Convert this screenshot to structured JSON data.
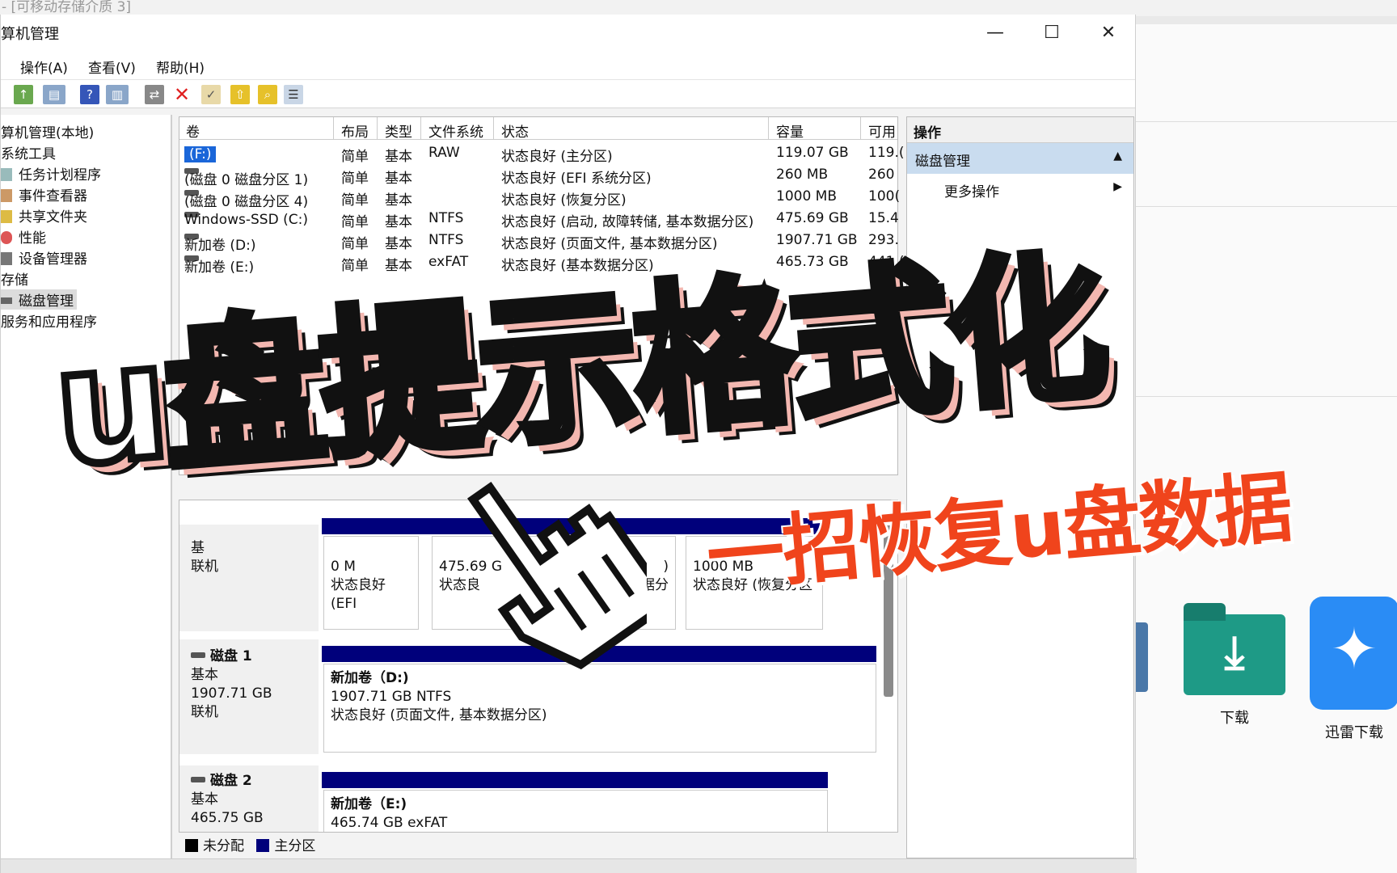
{
  "background": {
    "top_title": "- [可移动存储介质 3]",
    "desktop_icons": [
      {
        "label": "下载",
        "icon": "download-folder-icon"
      },
      {
        "label": "迅雷下载",
        "icon": "thunder-bird-icon"
      }
    ]
  },
  "window": {
    "title": "算机管理",
    "controls": {
      "minimize": "—",
      "maximize": "☐",
      "close": "✕"
    },
    "menu": [
      "操作(A)",
      "查看(V)",
      "帮助(H)"
    ]
  },
  "tree": {
    "items": [
      "算机管理(本地)",
      "系统工具",
      "任务计划程序",
      "事件查看器",
      "共享文件夹",
      "性能",
      "设备管理器",
      "存储",
      "磁盘管理",
      "服务和应用程序"
    ]
  },
  "volumes": {
    "columns": [
      "卷",
      "布局",
      "类型",
      "文件系统",
      "状态",
      "容量",
      "可用"
    ],
    "rows": [
      {
        "name": "(F:)",
        "layout": "简单",
        "type": "基本",
        "fs": "RAW",
        "status": "状态良好 (主分区)",
        "capacity": "119.07 GB",
        "free": "119.("
      },
      {
        "name": "(磁盘 0 磁盘分区 1)",
        "layout": "简单",
        "type": "基本",
        "fs": "",
        "status": "状态良好 (EFI 系统分区)",
        "capacity": "260 MB",
        "free": "260"
      },
      {
        "name": "(磁盘 0 磁盘分区 4)",
        "layout": "简单",
        "type": "基本",
        "fs": "",
        "status": "状态良好 (恢复分区)",
        "capacity": "1000 MB",
        "free": "100("
      },
      {
        "name": "Windows-SSD (C:)",
        "layout": "简单",
        "type": "基本",
        "fs": "NTFS",
        "status": "状态良好 (启动, 故障转储, 基本数据分区)",
        "capacity": "475.69 GB",
        "free": "15.4"
      },
      {
        "name": "新加卷 (D:)",
        "layout": "简单",
        "type": "基本",
        "fs": "NTFS",
        "status": "状态良好 (页面文件, 基本数据分区)",
        "capacity": "1907.71 GB",
        "free": "293."
      },
      {
        "name": "新加卷 (E:)",
        "layout": "简单",
        "type": "基本",
        "fs": "exFAT",
        "status": "状态良好 (基本数据分区)",
        "capacity": "465.73 GB",
        "free": "441.("
      }
    ]
  },
  "disks": {
    "disk0": {
      "label_lines": [
        "基",
        "",
        "联机"
      ],
      "parts": [
        {
          "line1": "0 M",
          "line2": "状态良好 (EFI"
        },
        {
          "line1": "475.69 G",
          "line2": "状态良"
        },
        {
          "line1": ")",
          "line2": "本数据分"
        },
        {
          "line1": "1000 MB",
          "line2": "状态良好 (恢复分区"
        }
      ]
    },
    "disk1": {
      "name": "磁盘 1",
      "type": "基本",
      "size": "1907.71 GB",
      "state": "联机",
      "part": {
        "title": "新加卷（D:)",
        "size": "1907.71 GB NTFS",
        "status": "状态良好 (页面文件, 基本数据分区)"
      }
    },
    "disk2": {
      "name": "磁盘 2",
      "type": "基本",
      "size": "465.75 GB",
      "part": {
        "title": "新加卷（E:)",
        "size": "465.74 GB exFAT"
      }
    }
  },
  "legend": {
    "unallocated": "未分配",
    "primary": "主分区"
  },
  "actions": {
    "header": "操作",
    "section": "磁盘管理",
    "item": "更多操作"
  },
  "overlay": {
    "title": "u盘提示格式化",
    "subtitle": "一招恢复u盘数据"
  },
  "colors": {
    "selection": "#1a66d9",
    "partition_bar": "#00007b",
    "action_section": "#c9dcef",
    "subtitle": "#f0441c",
    "title_shadow": "#f3b7b0"
  }
}
